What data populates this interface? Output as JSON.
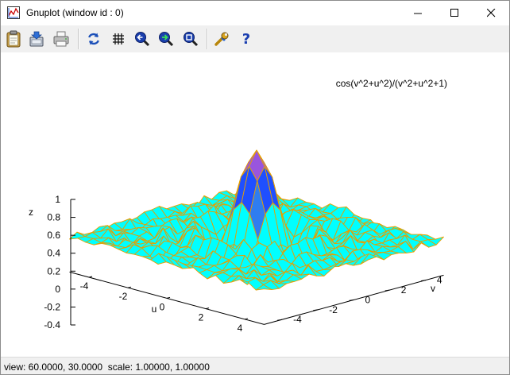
{
  "window": {
    "title": "Gnuplot (window id : 0)"
  },
  "toolbar": {
    "buttons": [
      {
        "icon": "clipboard-icon"
      },
      {
        "icon": "save-icon"
      },
      {
        "icon": "print-icon"
      },
      {
        "icon": "replot-icon"
      },
      {
        "icon": "grid-icon"
      },
      {
        "icon": "zoom-previous-icon"
      },
      {
        "icon": "zoom-next-icon"
      },
      {
        "icon": "unzoom-icon"
      },
      {
        "icon": "options-wrench-icon"
      },
      {
        "icon": "help-icon"
      }
    ]
  },
  "chart_data": {
    "type": "surface",
    "function": "cos(v^2+u^2)/(v^2+u^2+1)",
    "legend": "cos(v^2+u^2)/(v^2+u^2+1)",
    "legend_position": "top-right",
    "xlabel": "u",
    "ylabel": "v",
    "zlabel": "z",
    "xrange": [
      -5,
      5
    ],
    "yrange": [
      -5,
      5
    ],
    "zrange": [
      -0.4,
      1
    ],
    "xticks": [
      "-4",
      "-2",
      "0",
      "2",
      "4"
    ],
    "yticks": [
      "-4",
      "-2",
      "0",
      "2",
      "4"
    ],
    "zticks": [
      "-0.4",
      "-0.2",
      "0",
      "0.2",
      "0.4",
      "0.6",
      "0.8",
      "1"
    ],
    "view": {
      "rot_x": 60,
      "rot_z": 30,
      "scale": 1,
      "scale_z": 1
    },
    "colors": {
      "surface_top": "#00ffff",
      "surface_peak": "#1f4fff",
      "peak_top": "#9955dd",
      "mesh": "#e69f00"
    }
  },
  "status": {
    "text": "view: 60.0000, 30.0000  scale: 1.00000, 1.00000"
  }
}
